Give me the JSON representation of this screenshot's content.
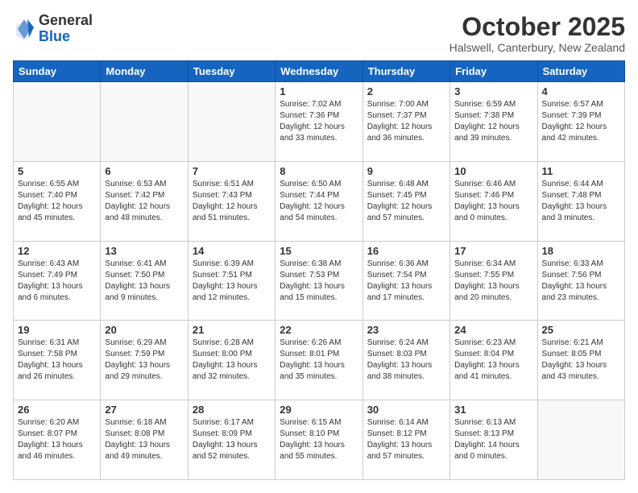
{
  "header": {
    "logo_general": "General",
    "logo_blue": "Blue",
    "month_title": "October 2025",
    "location": "Halswell, Canterbury, New Zealand"
  },
  "weekdays": [
    "Sunday",
    "Monday",
    "Tuesday",
    "Wednesday",
    "Thursday",
    "Friday",
    "Saturday"
  ],
  "weeks": [
    [
      {
        "day": "",
        "info": ""
      },
      {
        "day": "",
        "info": ""
      },
      {
        "day": "",
        "info": ""
      },
      {
        "day": "1",
        "info": "Sunrise: 7:02 AM\nSunset: 7:36 PM\nDaylight: 12 hours\nand 33 minutes."
      },
      {
        "day": "2",
        "info": "Sunrise: 7:00 AM\nSunset: 7:37 PM\nDaylight: 12 hours\nand 36 minutes."
      },
      {
        "day": "3",
        "info": "Sunrise: 6:59 AM\nSunset: 7:38 PM\nDaylight: 12 hours\nand 39 minutes."
      },
      {
        "day": "4",
        "info": "Sunrise: 6:57 AM\nSunset: 7:39 PM\nDaylight: 12 hours\nand 42 minutes."
      }
    ],
    [
      {
        "day": "5",
        "info": "Sunrise: 6:55 AM\nSunset: 7:40 PM\nDaylight: 12 hours\nand 45 minutes."
      },
      {
        "day": "6",
        "info": "Sunrise: 6:53 AM\nSunset: 7:42 PM\nDaylight: 12 hours\nand 48 minutes."
      },
      {
        "day": "7",
        "info": "Sunrise: 6:51 AM\nSunset: 7:43 PM\nDaylight: 12 hours\nand 51 minutes."
      },
      {
        "day": "8",
        "info": "Sunrise: 6:50 AM\nSunset: 7:44 PM\nDaylight: 12 hours\nand 54 minutes."
      },
      {
        "day": "9",
        "info": "Sunrise: 6:48 AM\nSunset: 7:45 PM\nDaylight: 12 hours\nand 57 minutes."
      },
      {
        "day": "10",
        "info": "Sunrise: 6:46 AM\nSunset: 7:46 PM\nDaylight: 13 hours\nand 0 minutes."
      },
      {
        "day": "11",
        "info": "Sunrise: 6:44 AM\nSunset: 7:48 PM\nDaylight: 13 hours\nand 3 minutes."
      }
    ],
    [
      {
        "day": "12",
        "info": "Sunrise: 6:43 AM\nSunset: 7:49 PM\nDaylight: 13 hours\nand 6 minutes."
      },
      {
        "day": "13",
        "info": "Sunrise: 6:41 AM\nSunset: 7:50 PM\nDaylight: 13 hours\nand 9 minutes."
      },
      {
        "day": "14",
        "info": "Sunrise: 6:39 AM\nSunset: 7:51 PM\nDaylight: 13 hours\nand 12 minutes."
      },
      {
        "day": "15",
        "info": "Sunrise: 6:38 AM\nSunset: 7:53 PM\nDaylight: 13 hours\nand 15 minutes."
      },
      {
        "day": "16",
        "info": "Sunrise: 6:36 AM\nSunset: 7:54 PM\nDaylight: 13 hours\nand 17 minutes."
      },
      {
        "day": "17",
        "info": "Sunrise: 6:34 AM\nSunset: 7:55 PM\nDaylight: 13 hours\nand 20 minutes."
      },
      {
        "day": "18",
        "info": "Sunrise: 6:33 AM\nSunset: 7:56 PM\nDaylight: 13 hours\nand 23 minutes."
      }
    ],
    [
      {
        "day": "19",
        "info": "Sunrise: 6:31 AM\nSunset: 7:58 PM\nDaylight: 13 hours\nand 26 minutes."
      },
      {
        "day": "20",
        "info": "Sunrise: 6:29 AM\nSunset: 7:59 PM\nDaylight: 13 hours\nand 29 minutes."
      },
      {
        "day": "21",
        "info": "Sunrise: 6:28 AM\nSunset: 8:00 PM\nDaylight: 13 hours\nand 32 minutes."
      },
      {
        "day": "22",
        "info": "Sunrise: 6:26 AM\nSunset: 8:01 PM\nDaylight: 13 hours\nand 35 minutes."
      },
      {
        "day": "23",
        "info": "Sunrise: 6:24 AM\nSunset: 8:03 PM\nDaylight: 13 hours\nand 38 minutes."
      },
      {
        "day": "24",
        "info": "Sunrise: 6:23 AM\nSunset: 8:04 PM\nDaylight: 13 hours\nand 41 minutes."
      },
      {
        "day": "25",
        "info": "Sunrise: 6:21 AM\nSunset: 8:05 PM\nDaylight: 13 hours\nand 43 minutes."
      }
    ],
    [
      {
        "day": "26",
        "info": "Sunrise: 6:20 AM\nSunset: 8:07 PM\nDaylight: 13 hours\nand 46 minutes."
      },
      {
        "day": "27",
        "info": "Sunrise: 6:18 AM\nSunset: 8:08 PM\nDaylight: 13 hours\nand 49 minutes."
      },
      {
        "day": "28",
        "info": "Sunrise: 6:17 AM\nSunset: 8:09 PM\nDaylight: 13 hours\nand 52 minutes."
      },
      {
        "day": "29",
        "info": "Sunrise: 6:15 AM\nSunset: 8:10 PM\nDaylight: 13 hours\nand 55 minutes."
      },
      {
        "day": "30",
        "info": "Sunrise: 6:14 AM\nSunset: 8:12 PM\nDaylight: 13 hours\nand 57 minutes."
      },
      {
        "day": "31",
        "info": "Sunrise: 6:13 AM\nSunset: 8:13 PM\nDaylight: 14 hours\nand 0 minutes."
      },
      {
        "day": "",
        "info": ""
      }
    ]
  ]
}
